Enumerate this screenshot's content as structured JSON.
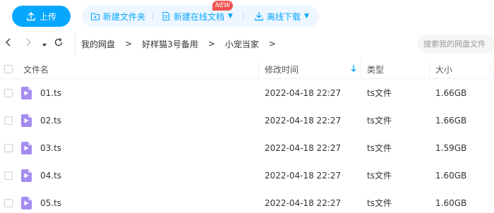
{
  "toolbar": {
    "upload_label": "上传",
    "new_folder_label": "新建文件夹",
    "new_doc_label": "新建在线文档",
    "new_badge": "NEW",
    "offline_download_label": "离线下载",
    "accent_color": "#06a7ff"
  },
  "nav": {
    "back_icon": "chevron-left-icon",
    "forward_icon": "chevron-right-icon",
    "history_icon": "dropdown-icon",
    "refresh_icon": "refresh-icon",
    "crumbs": [
      "我的网盘",
      "好样猫3号备用",
      "小宠当家"
    ],
    "crumb_sep": ">",
    "search_placeholder": "搜索我的网盘文件"
  },
  "table": {
    "headers": {
      "name": "文件名",
      "modified": "修改时间",
      "type": "类型",
      "size": "大小"
    },
    "sort_icon": "arrow-down-icon",
    "rows": [
      {
        "name": "01.ts",
        "modified": "2022-04-18 22:27",
        "type": "ts文件",
        "size": "1.66GB"
      },
      {
        "name": "02.ts",
        "modified": "2022-04-18 22:27",
        "type": "ts文件",
        "size": "1.66GB"
      },
      {
        "name": "03.ts",
        "modified": "2022-04-18 22:27",
        "type": "ts文件",
        "size": "1.59GB"
      },
      {
        "name": "04.ts",
        "modified": "2022-04-18 22:27",
        "type": "ts文件",
        "size": "1.60GB"
      },
      {
        "name": "05.ts",
        "modified": "2022-04-18 22:27",
        "type": "ts文件",
        "size": "1.60GB"
      }
    ]
  }
}
